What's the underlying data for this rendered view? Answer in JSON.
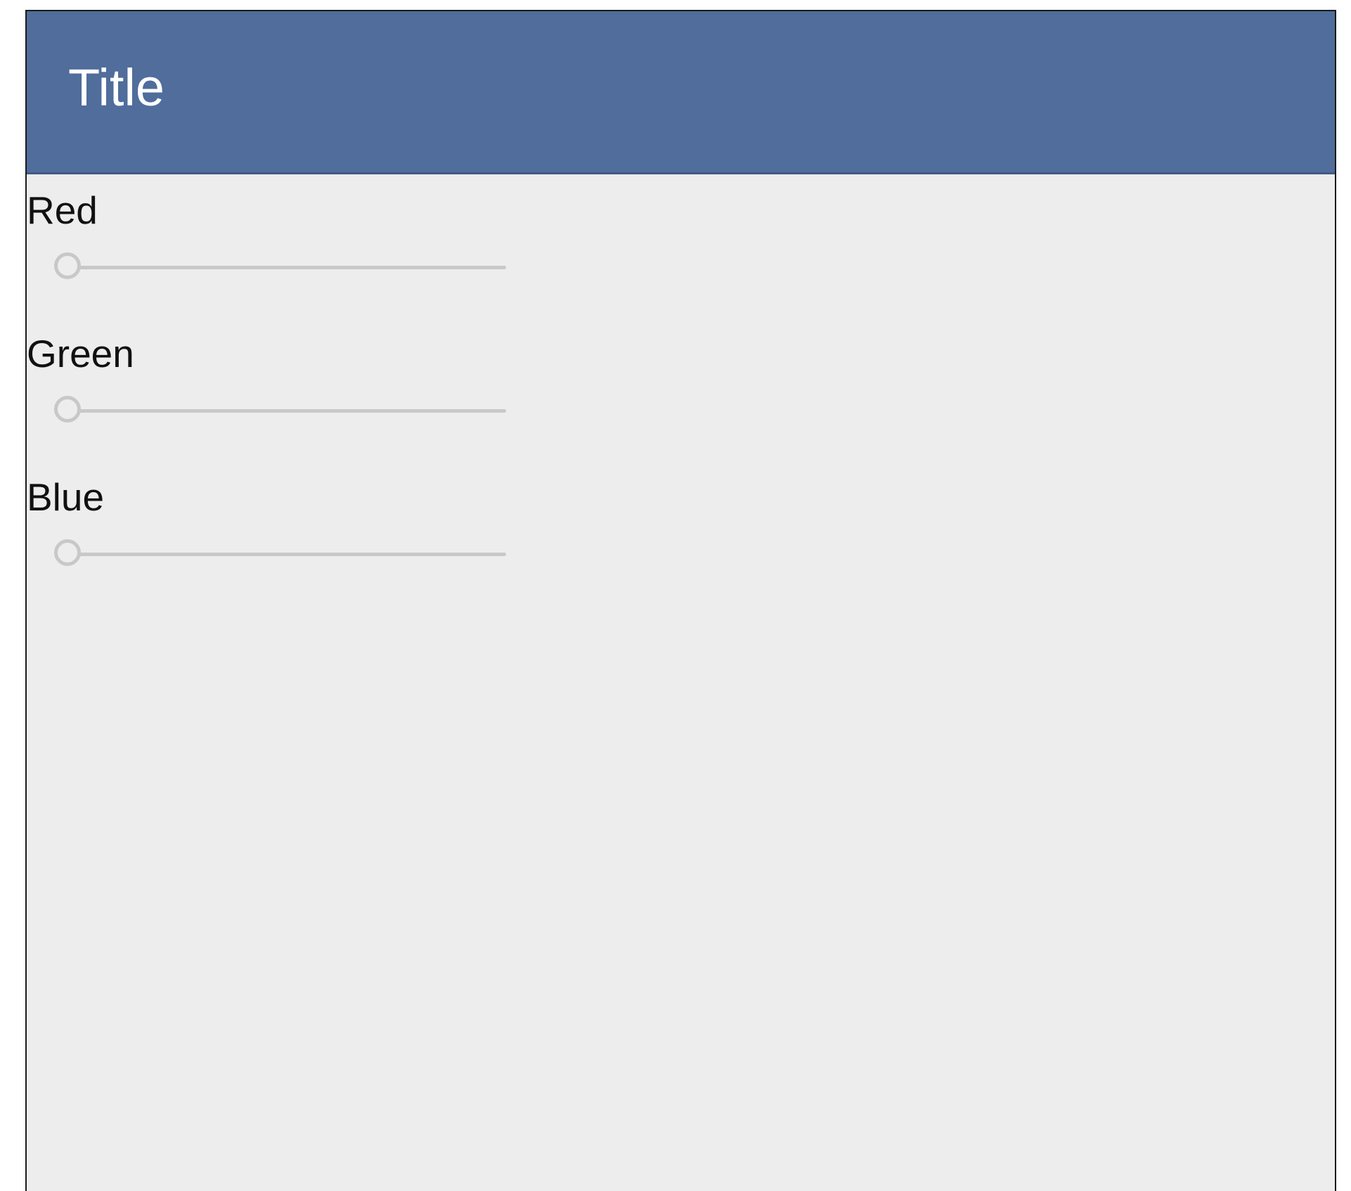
{
  "header": {
    "title": "Title"
  },
  "sliders": [
    {
      "label": "Red",
      "value": 0
    },
    {
      "label": "Green",
      "value": 0
    },
    {
      "label": "Blue",
      "value": 0
    }
  ],
  "colors": {
    "app_bar": "#506d9b",
    "background": "#ededed",
    "slider": "#c8c8c8"
  }
}
